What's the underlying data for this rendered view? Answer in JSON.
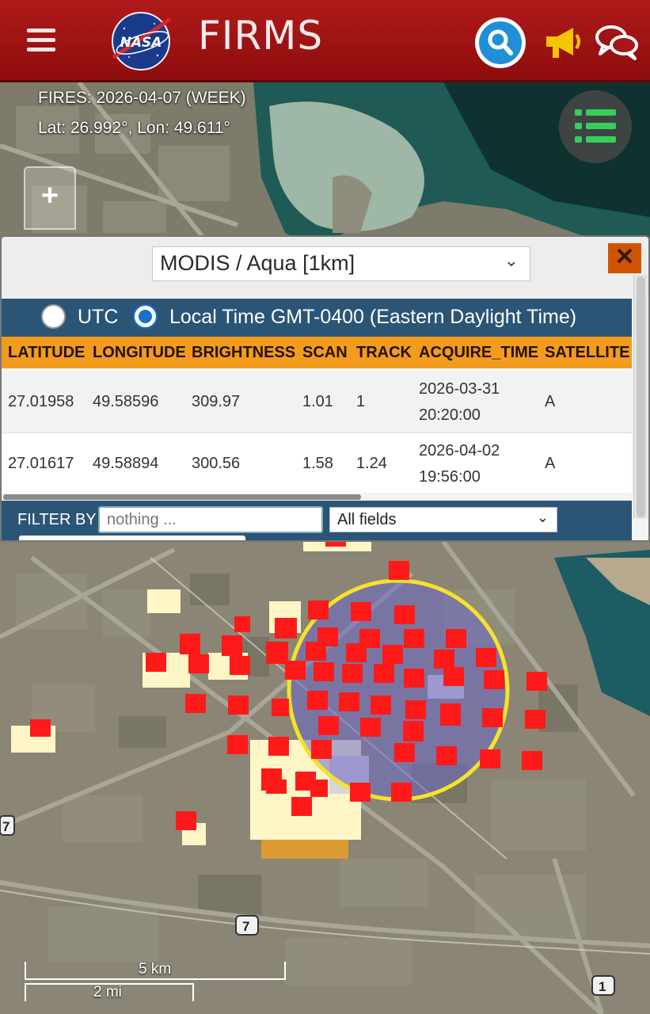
{
  "header": {
    "app_title": "FIRMS",
    "logo_text": "NASA",
    "icons": [
      "menu-icon",
      "search-icon",
      "megaphone-icon",
      "chat-icon"
    ]
  },
  "map": {
    "fires_label": "FIRES: 2026-04-07 (WEEK)",
    "coords_label": "Lat: 26.992°, Lon: 49.611°",
    "zoom_in_label": "+",
    "route_shields": [
      "7",
      "7",
      "1"
    ],
    "scale": {
      "km": "5 km",
      "mi": "2 mi"
    }
  },
  "panel": {
    "sensor": "MODIS / Aqua [1km]",
    "close_label": "✕",
    "timezone": {
      "utc_label": "UTC",
      "local_label": "Local Time GMT-0400 (Eastern Daylight Time)",
      "selected": "local"
    },
    "columns": [
      "LATITUDE",
      "LONGITUDE",
      "BRIGHTNESS",
      "SCAN",
      "TRACK",
      "ACQUIRE_TIME",
      "SATELLITE"
    ],
    "rows": [
      {
        "latitude": "27.01958",
        "longitude": "49.58596",
        "brightness": "309.97",
        "scan": "1.01",
        "track": "1",
        "acquire_date": "2026-03-31",
        "acquire_time": "20:20:00",
        "satellite": "A"
      },
      {
        "latitude": "27.01617",
        "longitude": "49.58894",
        "brightness": "300.56",
        "scan": "1.58",
        "track": "1.24",
        "acquire_date": "2026-04-02",
        "acquire_time": "19:56:00",
        "satellite": "A"
      }
    ],
    "filter": {
      "label": "FILTER BY",
      "placeholder": "nothing ...",
      "field": "All fields"
    }
  },
  "colors": {
    "header_red": "#a01414",
    "panel_blue": "#2b5576",
    "table_header_orange": "#f29b1d",
    "close_orange": "#d35400",
    "fire_red": "#ff1a1a",
    "fire_cream": "#fff6c8",
    "selection_yellow": "#f7e22a",
    "selection_fill": "#7a76c8"
  }
}
